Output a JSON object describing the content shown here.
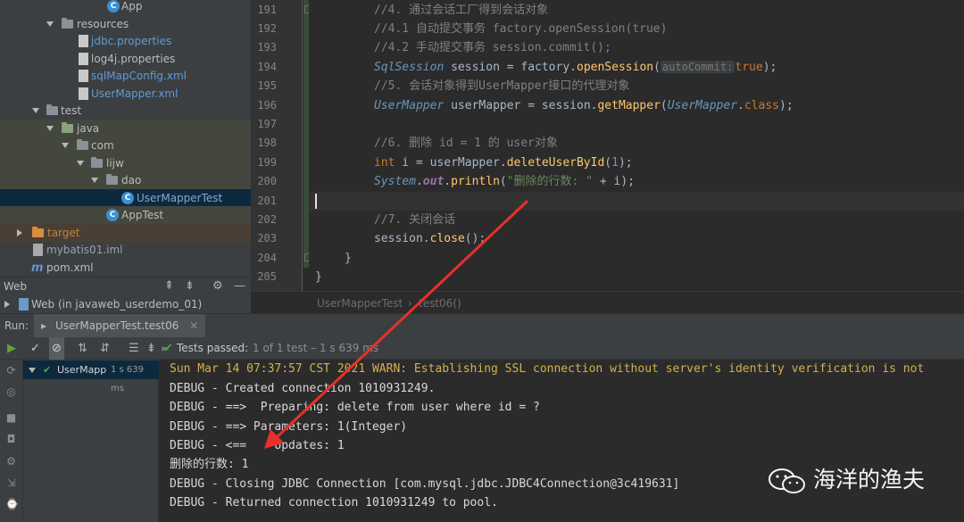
{
  "project_tree": {
    "items": [
      {
        "label": "App",
        "icon": "java-class-icon"
      },
      {
        "label": "resources",
        "icon": "resources-folder-icon"
      },
      {
        "label": "jdbc.properties",
        "icon": "properties-file-icon"
      },
      {
        "label": "log4j.properties",
        "icon": "properties-file-icon"
      },
      {
        "label": "sqlMapConfig.xml",
        "icon": "xml-file-icon"
      },
      {
        "label": "UserMapper.xml",
        "icon": "xml-file-icon"
      },
      {
        "label": "test",
        "icon": "folder-icon"
      },
      {
        "label": "java",
        "icon": "test-source-folder-icon"
      },
      {
        "label": "com",
        "icon": "package-icon"
      },
      {
        "label": "lijw",
        "icon": "package-icon"
      },
      {
        "label": "dao",
        "icon": "package-icon"
      },
      {
        "label": "UserMapperTest",
        "icon": "java-class-icon"
      },
      {
        "label": "AppTest",
        "icon": "java-class-icon"
      },
      {
        "label": "target",
        "icon": "excluded-folder-icon"
      },
      {
        "label": "mybatis01.iml",
        "icon": "module-file-icon"
      },
      {
        "label": "pom.xml",
        "icon": "maven-icon"
      }
    ]
  },
  "web_panel": {
    "title": "Web",
    "item": "Web (in javaweb_userdemo_01)"
  },
  "editor": {
    "lines": [
      {
        "n": "191"
      },
      {
        "n": "192"
      },
      {
        "n": "193"
      },
      {
        "n": "194"
      },
      {
        "n": "195"
      },
      {
        "n": "196"
      },
      {
        "n": "197"
      },
      {
        "n": "198"
      },
      {
        "n": "199"
      },
      {
        "n": "200"
      },
      {
        "n": "201"
      },
      {
        "n": "202"
      },
      {
        "n": "203"
      },
      {
        "n": "204"
      },
      {
        "n": "205"
      }
    ],
    "code": {
      "l191": "//4. 通过会话工厂得到会话对象",
      "l192": "//4.1 自动提交事务 factory.openSession(true)",
      "l193": "//4.2 手动提交事务 session.commit();",
      "l194_type": "SqlSession",
      "l194_var": " session = factory.",
      "l194_method": "openSession",
      "l194_open": "(",
      "l194_hint": "autoCommit:",
      "l194_true": "true",
      "l194_end": ");",
      "l195": "//5. 会话对象得到UserMapper接口的代理对象",
      "l196_type": "UserMapper",
      "l196_mid": " userMapper = session.",
      "l196_method": "getMapper",
      "l196_open": "(",
      "l196_cls": "UserMapper",
      "l196_dot": ".",
      "l196_kw": "class",
      "l196_end": ");",
      "l198": "//6. 删除 id = 1 的 user对象",
      "l199_kw": "int",
      "l199_mid": " i = userMapper.",
      "l199_method": "deleteUserById",
      "l199_open": "(",
      "l199_num": "1",
      "l199_end": ");",
      "l200_type": "System",
      "l200_dot": ".",
      "l200_field": "out",
      "l200_dot2": ".",
      "l200_method": "println",
      "l200_open": "(",
      "l200_str": "\"删除的行数: \"",
      "l200_end": " + i);",
      "l202": "//7. 关闭会话",
      "l203_pre": "session.",
      "l203_method": "close",
      "l203_end": "();",
      "l204": "}",
      "l205": "}"
    },
    "breadcrumb": {
      "class": "UserMapperTest",
      "sep": "›",
      "method": "test06()"
    }
  },
  "run_panel": {
    "label": "Run:",
    "tab": "UserMapperTest.test06",
    "status_passed": "Tests passed:",
    "status_detail": "1 of 1 test – 1 s 639 ms",
    "test_node": "UserMapp",
    "test_time": "1 s 639 ms",
    "console": [
      "Sun Mar 14 07:37:57 CST 2021 WARN: Establishing SSL connection without server's identity verification is not",
      "DEBUG - Created connection 1010931249.",
      "DEBUG - ==>  Preparing: delete from user where id = ?",
      "DEBUG - ==> Parameters: 1(Integer)",
      "DEBUG - <==    Updates: 1",
      "删除的行数: 1",
      "DEBUG - Closing JDBC Connection [com.mysql.jdbc.JDBC4Connection@3c419631]",
      "DEBUG - Returned connection 1010931249 to pool."
    ]
  },
  "watermark": {
    "text": "海洋的渔夫",
    "icon": "wechat-icon"
  },
  "colors": {
    "annotation_arrow": "#e8302a",
    "editor_bg": "#2b2b2b",
    "panel_bg": "#3c3f41",
    "test_pass": "#5fa33f"
  }
}
